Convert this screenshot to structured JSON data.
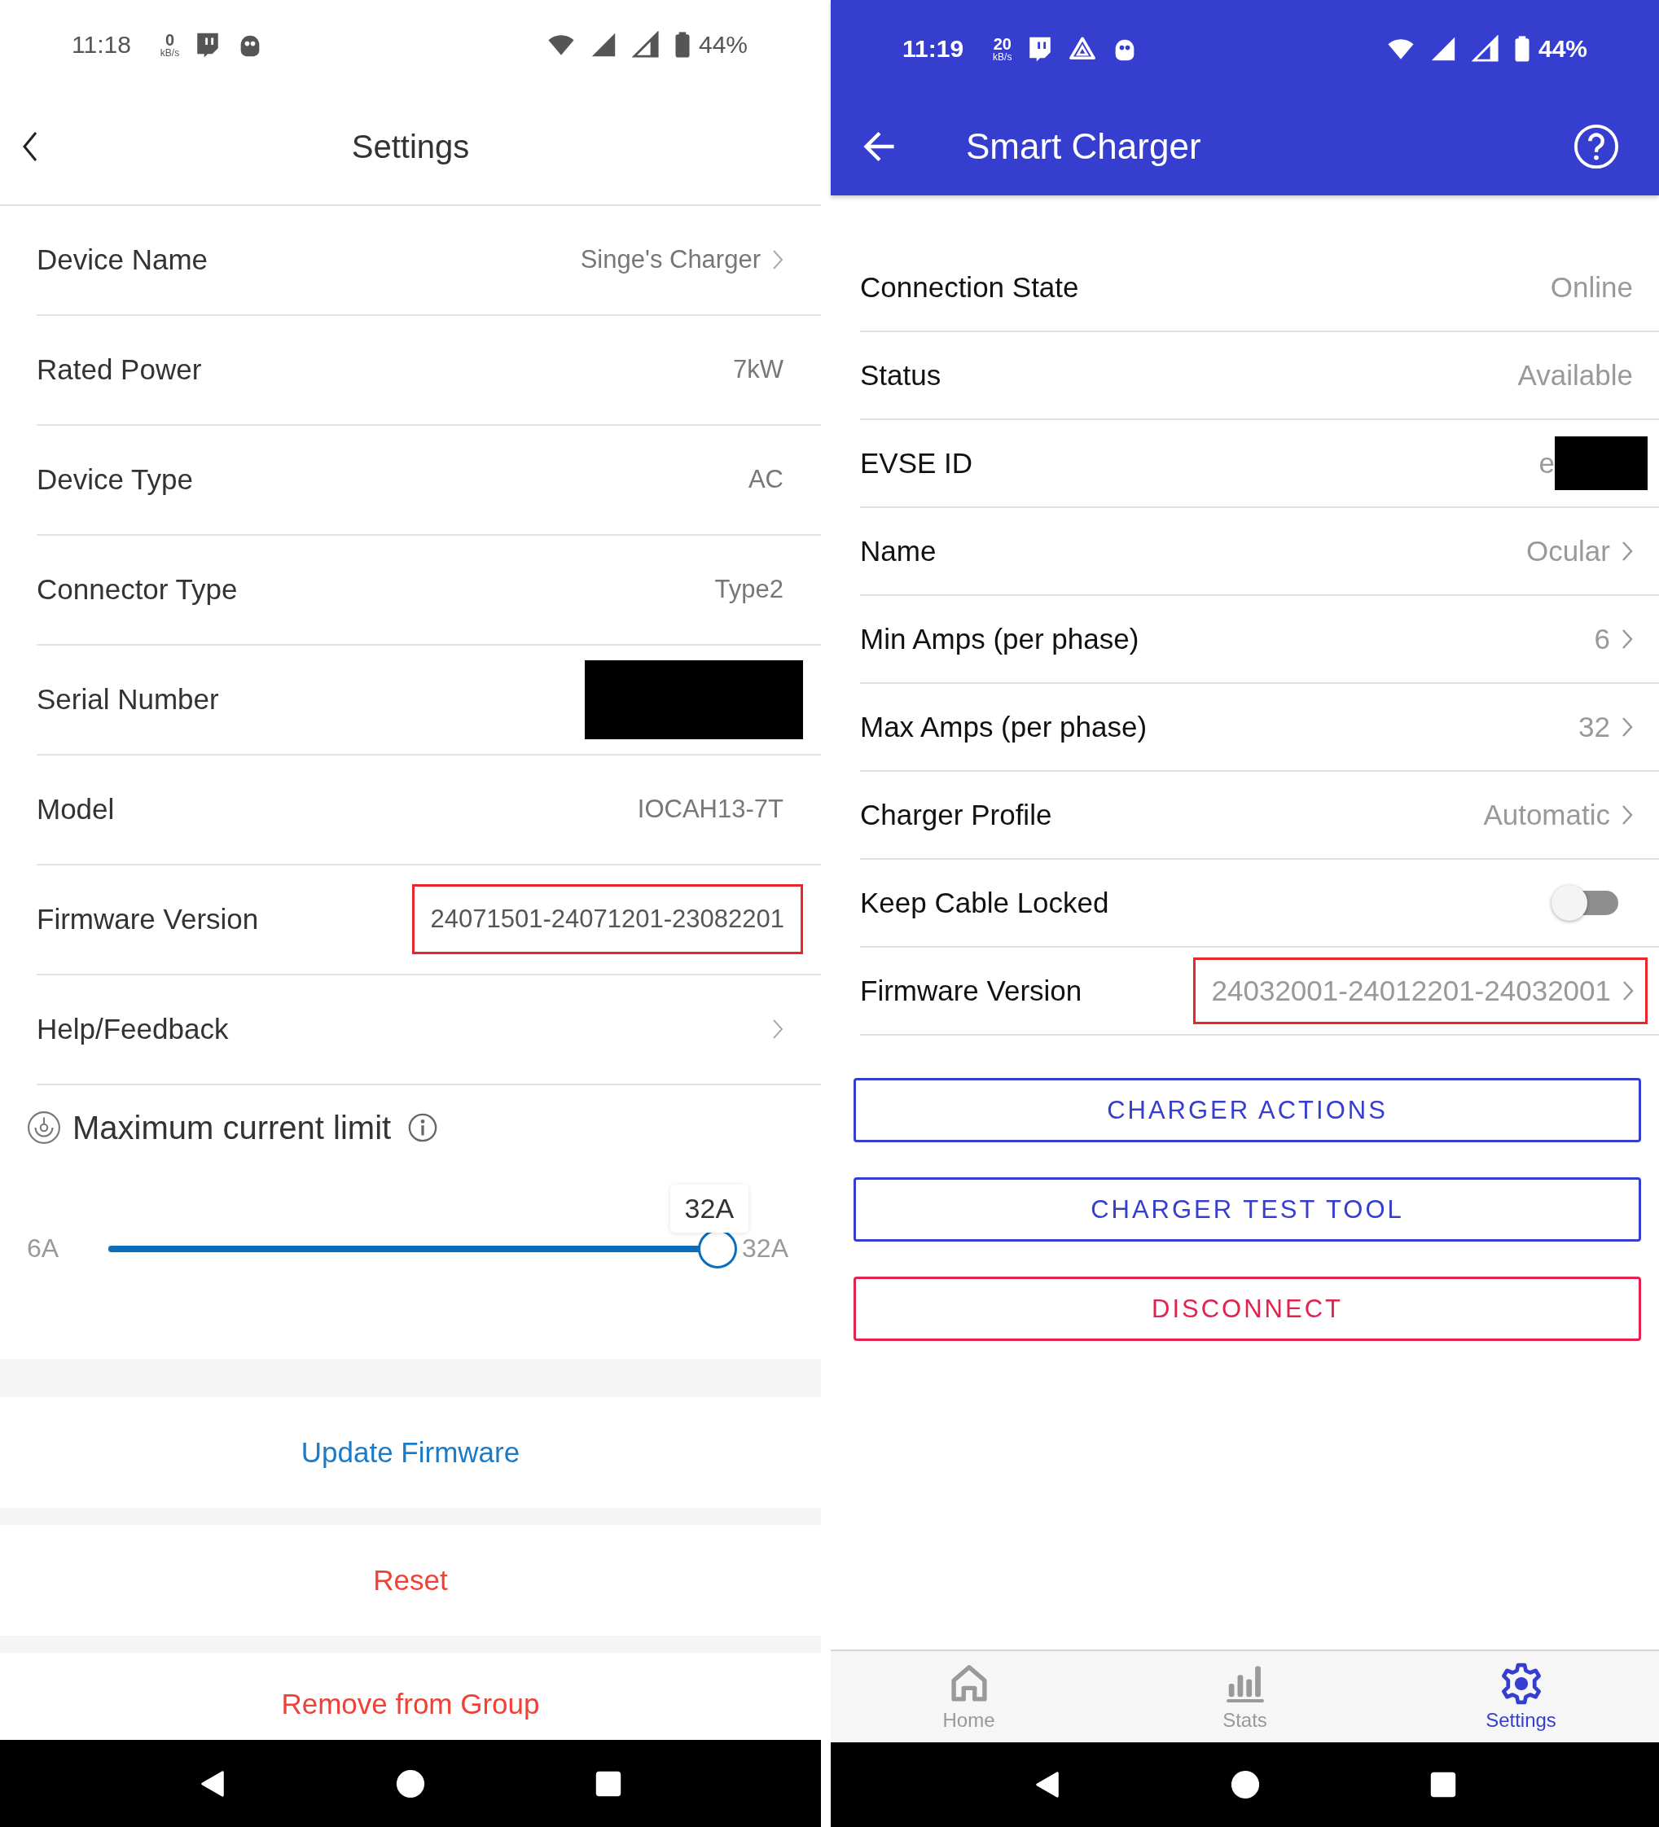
{
  "left": {
    "status_bar": {
      "time": "11:18",
      "speed": "0",
      "speed_unit": "kB/s",
      "battery": "44%"
    },
    "title": "Settings",
    "rows": [
      {
        "label": "Device Name",
        "value": "Singe's Charger",
        "chevron": true
      },
      {
        "label": "Rated Power",
        "value": "7kW"
      },
      {
        "label": "Device Type",
        "value": "AC"
      },
      {
        "label": "Connector Type",
        "value": "Type2"
      },
      {
        "label": "Serial Number",
        "redacted": true
      },
      {
        "label": "Model",
        "value": "IOCAH13-7T"
      },
      {
        "label": "Firmware Version",
        "value": "24071501-24071201-23082201",
        "highlighted": true
      },
      {
        "label": "Help/Feedback",
        "chevron": true
      }
    ],
    "current_limit": {
      "title": "Maximum current limit",
      "min_label": "6A",
      "max_label": "32A",
      "tooltip": "32A"
    },
    "actions": [
      {
        "label": "Update Firmware",
        "kind": "primary"
      },
      {
        "label": "Reset",
        "kind": "danger"
      },
      {
        "label": "Remove from Group",
        "kind": "danger"
      }
    ]
  },
  "right": {
    "status_bar": {
      "time": "11:19",
      "speed": "20",
      "speed_unit": "kB/s",
      "battery": "44%"
    },
    "title": "Smart Charger",
    "rows": [
      {
        "kind": "value",
        "label": "Connection State",
        "value": "Online"
      },
      {
        "kind": "value",
        "label": "Status",
        "value": "Available"
      },
      {
        "kind": "value",
        "label": "EVSE ID",
        "value": "e",
        "redacted": true
      },
      {
        "kind": "value",
        "label": "Name",
        "value": "Ocular",
        "chevron": true
      },
      {
        "kind": "value",
        "label": "Min Amps (per phase)",
        "value": "6",
        "chevron": true
      },
      {
        "kind": "value",
        "label": "Max Amps (per phase)",
        "value": "32",
        "chevron": true
      },
      {
        "kind": "value",
        "label": "Charger Profile",
        "value": "Automatic",
        "chevron": true
      },
      {
        "kind": "toggle",
        "label": "Keep Cable Locked",
        "on": false
      },
      {
        "kind": "value",
        "label": "Firmware Version",
        "value": "24032001-24012201-24032001",
        "chevron": true,
        "highlighted": true
      }
    ],
    "buttons": [
      {
        "label": "CHARGER ACTIONS",
        "kind": "primary"
      },
      {
        "label": "CHARGER TEST TOOL",
        "kind": "primary"
      },
      {
        "label": "DISCONNECT",
        "kind": "danger"
      }
    ],
    "tabs": [
      {
        "label": "Home",
        "kind": "home",
        "selected": false
      },
      {
        "label": "Stats",
        "kind": "stats",
        "selected": false
      },
      {
        "label": "Settings",
        "kind": "settings",
        "selected": true
      }
    ]
  }
}
